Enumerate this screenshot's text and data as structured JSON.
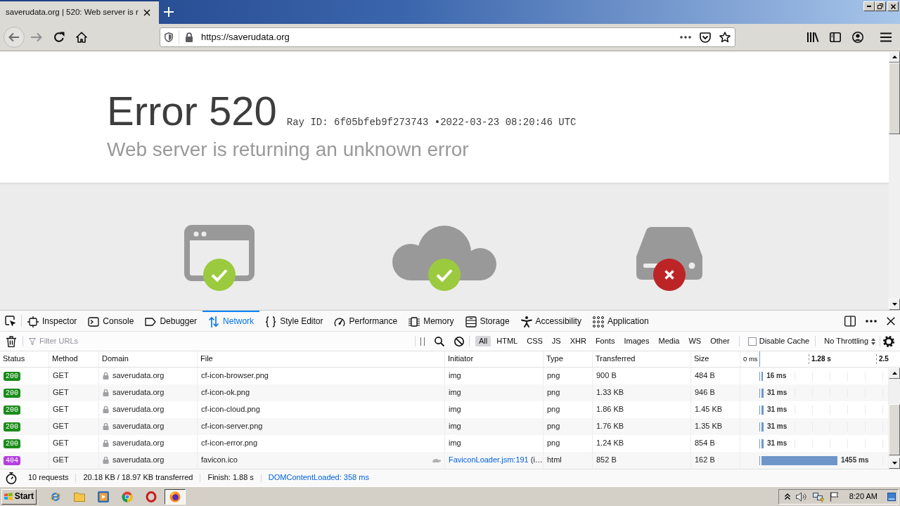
{
  "browser_tab": {
    "title": "saverudata.org | 520: Web server is r"
  },
  "address_bar": {
    "url": "https://saverudata.org"
  },
  "page": {
    "heading": "Error 520",
    "ray_line": "Ray ID: 6f05bfeb9f273743 •2022-03-23 08:20:46 UTC",
    "subtitle": "Web server is returning an unknown error",
    "steps": [
      {
        "kind": "browser",
        "error": false
      },
      {
        "kind": "cloud",
        "error": false
      },
      {
        "kind": "server",
        "error": true
      }
    ]
  },
  "devtools": {
    "tabs": [
      {
        "kind": "inspector",
        "label": "Inspector",
        "selected": false
      },
      {
        "kind": "console",
        "label": "Console",
        "selected": false
      },
      {
        "kind": "debugger",
        "label": "Debugger",
        "selected": false
      },
      {
        "kind": "network",
        "label": "Network",
        "selected": true
      },
      {
        "kind": "style_editor",
        "label": "Style Editor",
        "selected": false
      },
      {
        "kind": "performance",
        "label": "Performance",
        "selected": false
      },
      {
        "kind": "memory",
        "label": "Memory",
        "selected": false
      },
      {
        "kind": "storage",
        "label": "Storage",
        "selected": false
      },
      {
        "kind": "accessibility",
        "label": "Accessibility",
        "selected": false
      },
      {
        "kind": "application",
        "label": "Application",
        "selected": false
      }
    ],
    "filter": {
      "placeholder": "Filter URLs"
    },
    "type_filters": [
      {
        "label": "All",
        "selected": true
      },
      {
        "label": "HTML",
        "selected": false
      },
      {
        "label": "CSS",
        "selected": false
      },
      {
        "label": "JS",
        "selected": false
      },
      {
        "label": "XHR",
        "selected": false
      },
      {
        "label": "Fonts",
        "selected": false
      },
      {
        "label": "Images",
        "selected": false
      },
      {
        "label": "Media",
        "selected": false
      },
      {
        "label": "WS",
        "selected": false
      },
      {
        "label": "Other",
        "selected": false
      }
    ],
    "disable_cache": {
      "label": "Disable Cache",
      "checked": false
    },
    "throttling": {
      "label": "No Throttling"
    },
    "table": {
      "columns": [
        "Status",
        "Method",
        "Domain",
        "File",
        "Initiator",
        "Type",
        "Transferred",
        "Size"
      ],
      "waterfall_ticks": [
        "0 ms",
        "1.28 s",
        "2.5"
      ],
      "rows": [
        {
          "status": "200",
          "color": "#1a8c1a",
          "method": "GET",
          "secure": true,
          "domain": "saverudata.org",
          "file": "cf-icon-browser.png",
          "slow": false,
          "initiator": "img",
          "type": "png",
          "transferred": "900 B",
          "size": "484 B",
          "level": 0.012,
          "timing": "16 ms"
        },
        {
          "status": "200",
          "color": "#1a8c1a",
          "method": "GET",
          "secure": true,
          "domain": "saverudata.org",
          "file": "cf-icon-ok.png",
          "slow": false,
          "initiator": "img",
          "type": "png",
          "transferred": "1.33 KB",
          "size": "946 B",
          "level": 0.016,
          "timing": "31 ms"
        },
        {
          "status": "200",
          "color": "#1a8c1a",
          "method": "GET",
          "secure": true,
          "domain": "saverudata.org",
          "file": "cf-icon-cloud.png",
          "slow": false,
          "initiator": "img",
          "type": "png",
          "transferred": "1.86 KB",
          "size": "1.45 KB",
          "level": 0.016,
          "timing": "31 ms"
        },
        {
          "status": "200",
          "color": "#1a8c1a",
          "method": "GET",
          "secure": true,
          "domain": "saverudata.org",
          "file": "cf-icon-server.png",
          "slow": false,
          "initiator": "img",
          "type": "png",
          "transferred": "1.76 KB",
          "size": "1.35 KB",
          "level": 0.016,
          "timing": "31 ms"
        },
        {
          "status": "200",
          "color": "#1a8c1a",
          "method": "GET",
          "secure": true,
          "domain": "saverudata.org",
          "file": "cf-icon-error.png",
          "slow": false,
          "initiator": "img",
          "type": "png",
          "transferred": "1.24 KB",
          "size": "854 B",
          "level": 0.016,
          "timing": "31 ms"
        },
        {
          "status": "404",
          "color": "#b43ee0",
          "method": "GET",
          "secure": true,
          "domain": "saverudata.org",
          "file": "favicon.ico",
          "slow": true,
          "initiator_link": "FaviconLoader.jsm:191",
          "initiator": "(i…",
          "type": "html",
          "transferred": "852 B",
          "size": "162 B",
          "level": 0.6,
          "timing": "1455 ms"
        }
      ]
    },
    "summary": {
      "requests": "10 requests",
      "transferred": "20.18 KB / 18.97 KB transferred",
      "finish": "Finish: 1.88 s",
      "dom_content_loaded": "DOMContentLoaded: 358 ms"
    }
  },
  "taskbar": {
    "start": "Start",
    "apps": [
      {
        "kind": "ie",
        "active": false
      },
      {
        "kind": "explorer",
        "active": false
      },
      {
        "kind": "media",
        "active": false
      },
      {
        "kind": "chrome",
        "active": false
      },
      {
        "kind": "opera",
        "active": false
      },
      {
        "kind": "firefox",
        "active": true
      }
    ],
    "clock": "8:20 AM"
  }
}
